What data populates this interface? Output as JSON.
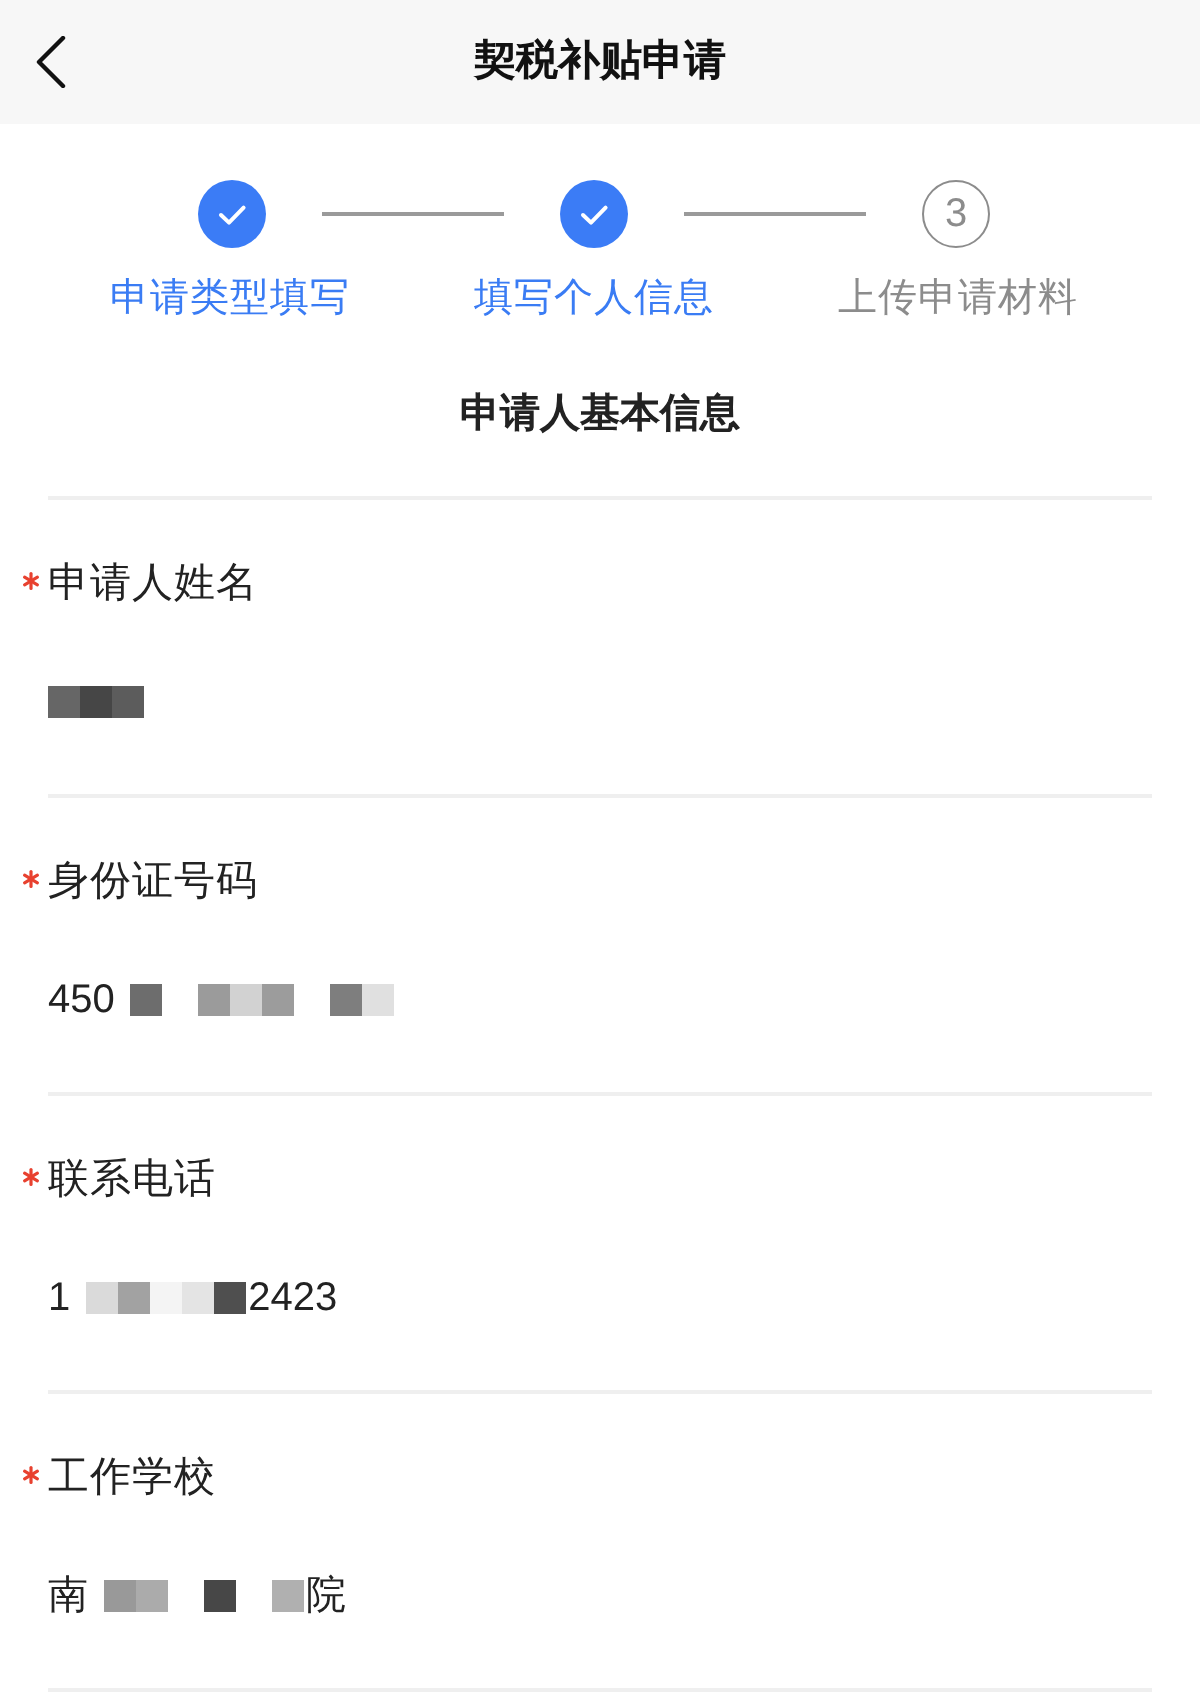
{
  "header": {
    "title": "契税补贴申请"
  },
  "steps": [
    {
      "label": "申请类型填写",
      "completed": true
    },
    {
      "label": "填写个人信息",
      "completed": true
    },
    {
      "label": "上传申请材料",
      "completed": false,
      "number": "3"
    }
  ],
  "section": {
    "title": "申请人基本信息"
  },
  "fields": [
    {
      "label": "申请人姓名",
      "required": true,
      "value": [
        {
          "kind": "mosaic",
          "tiles": [
            {
              "color": "#666666"
            },
            {
              "color": "#464646"
            },
            {
              "color": "#5c5c5c"
            }
          ]
        }
      ]
    },
    {
      "label": "身份证号码",
      "required": true,
      "value": [
        {
          "kind": "text",
          "text": "450"
        },
        {
          "kind": "mosaic",
          "tiles": [
            {
              "color": "#6d6d6d"
            }
          ]
        },
        {
          "kind": "mosaic",
          "tiles": [
            {
              "color": "#9b9b9b"
            },
            {
              "color": "#d2d2d2"
            },
            {
              "color": "#9c9c9c"
            }
          ]
        },
        {
          "kind": "mosaic",
          "tiles": [
            {
              "color": "#7e7e7e"
            },
            {
              "color": "#e0e0e0"
            }
          ]
        }
      ]
    },
    {
      "label": "联系电话",
      "required": true,
      "value": [
        {
          "kind": "text",
          "text": "1"
        },
        {
          "kind": "mosaic",
          "tiles": [
            {
              "color": "#dadada"
            },
            {
              "color": "#a2a2a2"
            },
            {
              "color": "#f4f4f4"
            },
            {
              "color": "#e4e4e4"
            },
            {
              "color": "#4f4f4f"
            }
          ]
        },
        {
          "kind": "text",
          "text": "2423"
        }
      ]
    },
    {
      "label": "工作学校",
      "required": true,
      "value": [
        {
          "kind": "text",
          "text": "南"
        },
        {
          "kind": "mosaic",
          "tiles": [
            {
              "color": "#999999"
            },
            {
              "color": "#ababab"
            }
          ]
        },
        {
          "kind": "mosaic",
          "tiles": [
            {
              "color": "#474747"
            }
          ]
        },
        {
          "kind": "mosaic",
          "tiles": [
            {
              "color": "#b0b0b0"
            }
          ]
        },
        {
          "kind": "text",
          "text": "院"
        }
      ]
    }
  ]
}
